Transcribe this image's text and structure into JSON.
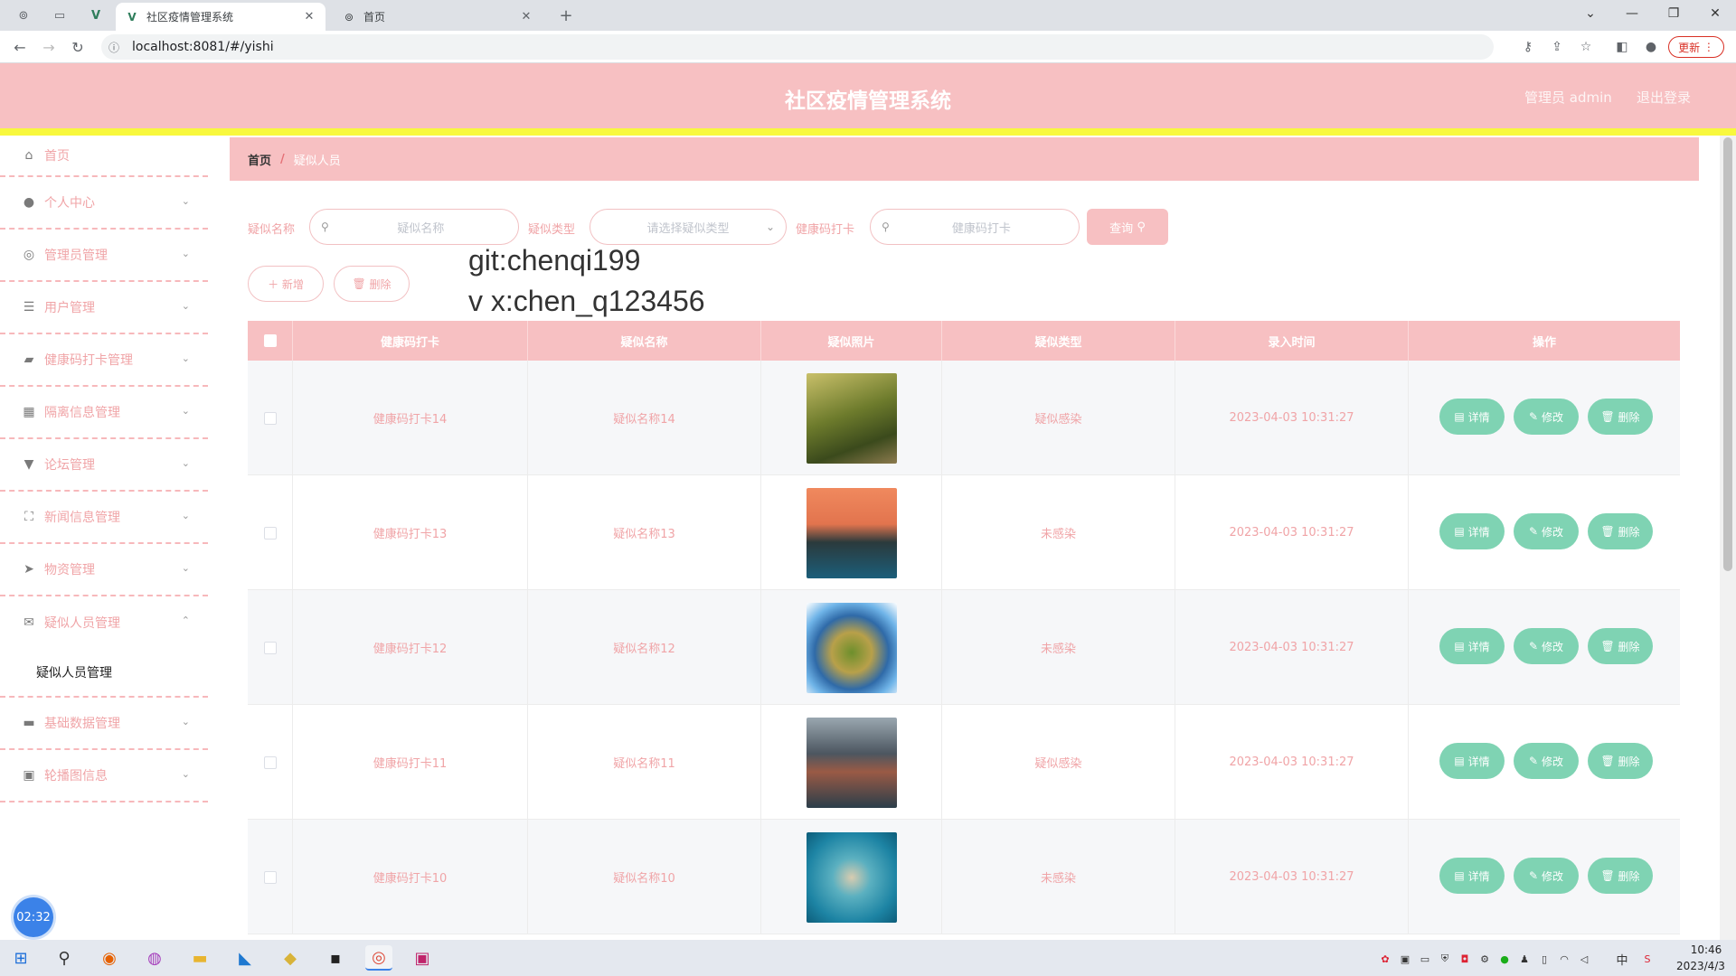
{
  "browser": {
    "tabs": [
      {
        "title": "社区疫情管理系统",
        "active": true
      },
      {
        "title": "首页",
        "active": false
      }
    ],
    "url": "localhost:8081/#/yishi",
    "update_label": "更新"
  },
  "header": {
    "title": "社区疫情管理系统",
    "user": "管理员 admin",
    "logout": "退出登录"
  },
  "sidebar": {
    "items": [
      {
        "label": "首页",
        "icon": "home-icon"
      },
      {
        "label": "个人中心",
        "icon": "user-icon"
      },
      {
        "label": "管理员管理",
        "icon": "settings-icon"
      },
      {
        "label": "用户管理",
        "icon": "sliders-icon"
      },
      {
        "label": "健康码打卡管理",
        "icon": "briefcase-icon"
      },
      {
        "label": "隔离信息管理",
        "icon": "grid-icon"
      },
      {
        "label": "论坛管理",
        "icon": "chat-icon"
      },
      {
        "label": "新闻信息管理",
        "icon": "fullscreen-icon"
      },
      {
        "label": "物资管理",
        "icon": "send-icon"
      },
      {
        "label": "疑似人员管理",
        "icon": "ticket-icon"
      },
      {
        "label": "基础数据管理",
        "icon": "monitor-icon"
      },
      {
        "label": "轮播图信息",
        "icon": "trash-box-icon"
      }
    ],
    "submenu_label": "疑似人员管理",
    "timer": "02:32"
  },
  "breadcrumb": {
    "home": "首页",
    "sep": "/",
    "current": "疑似人员"
  },
  "search": {
    "name_label": "疑似名称",
    "name_placeholder": "疑似名称",
    "type_label": "疑似类型",
    "type_placeholder": "请选择疑似类型",
    "health_label": "健康码打卡",
    "health_placeholder": "健康码打卡",
    "query_label": "查询"
  },
  "actions": {
    "add_label": "新增",
    "delete_label": "删除"
  },
  "overlay": {
    "line1": "git:chenqi199",
    "line2": "v x:chen_q123456"
  },
  "table": {
    "columns": [
      "健康码打卡",
      "疑似名称",
      "疑似照片",
      "疑似类型",
      "录入时间",
      "操作"
    ],
    "op_labels": {
      "detail": "详情",
      "edit": "修改",
      "delete": "删除"
    },
    "rows": [
      {
        "health": "健康码打卡14",
        "name": "疑似名称14",
        "photo": "forest-path",
        "type": "疑似感染",
        "time": "2023-04-03 10:31:27"
      },
      {
        "health": "健康码打卡13",
        "name": "疑似名称13",
        "photo": "sunset-lake",
        "type": "未感染",
        "time": "2023-04-03 10:31:27"
      },
      {
        "health": "健康码打卡12",
        "name": "疑似名称12",
        "photo": "tiny-planet",
        "type": "未感染",
        "time": "2023-04-03 10:31:27"
      },
      {
        "health": "健康码打卡11",
        "name": "疑似名称11",
        "photo": "mountain-village",
        "type": "疑似感染",
        "time": "2023-04-03 10:31:27"
      },
      {
        "health": "健康码打卡10",
        "name": "疑似名称10",
        "photo": "heart-island",
        "type": "未感染",
        "time": "2023-04-03 10:31:27"
      }
    ]
  },
  "taskbar": {
    "time": "10:46",
    "date": "2023/4/3",
    "ime": "中"
  },
  "colors": {
    "header_pink": "#f7c0c2",
    "accent_text": "#f0a4a7",
    "op_green": "#7fd3b3",
    "yellow": "#f8f83e"
  }
}
